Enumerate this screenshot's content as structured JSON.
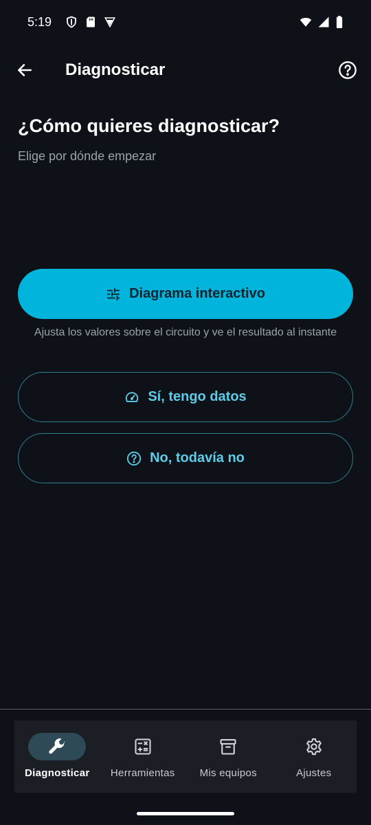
{
  "status_bar": {
    "time": "5:19",
    "left_icons": [
      "shield-icon",
      "sd-card-icon",
      "vpn-icon"
    ],
    "right_icons": [
      "wifi-icon",
      "cell-signal-icon",
      "battery-icon"
    ]
  },
  "app_bar": {
    "title": "Diagnosticar",
    "back_icon": "arrow-left-icon",
    "help_icon": "help-circle-icon"
  },
  "main": {
    "headline": "¿Cómo quieres diagnosticar?",
    "subhead": "Elige por dónde empezar",
    "primary_button": {
      "label": "Diagrama interactivo",
      "icon": "sliders-icon"
    },
    "primary_hint": "Ajusta los valores sobre el circuito y ve el resultado al instante",
    "data_button": {
      "label": "Sí, tengo datos",
      "icon": "gauge-icon"
    },
    "no_data_button": {
      "label": "No, todavía no",
      "icon": "help-circle-icon"
    }
  },
  "bottom_nav": {
    "items": [
      {
        "label": "Diagnosticar",
        "icon": "wrench-icon",
        "active": true
      },
      {
        "label": "Herramientas",
        "icon": "calculator-icon",
        "active": false
      },
      {
        "label": "Mis equipos",
        "icon": "archive-box-icon",
        "active": false
      },
      {
        "label": "Ajustes",
        "icon": "gear-icon",
        "active": false
      }
    ]
  },
  "colors": {
    "background": "#0e1117",
    "accent": "#00b4db",
    "accent_text": "#5ccde8",
    "nav_background": "#1b1f25",
    "nav_active_pill": "#2f4a57"
  }
}
